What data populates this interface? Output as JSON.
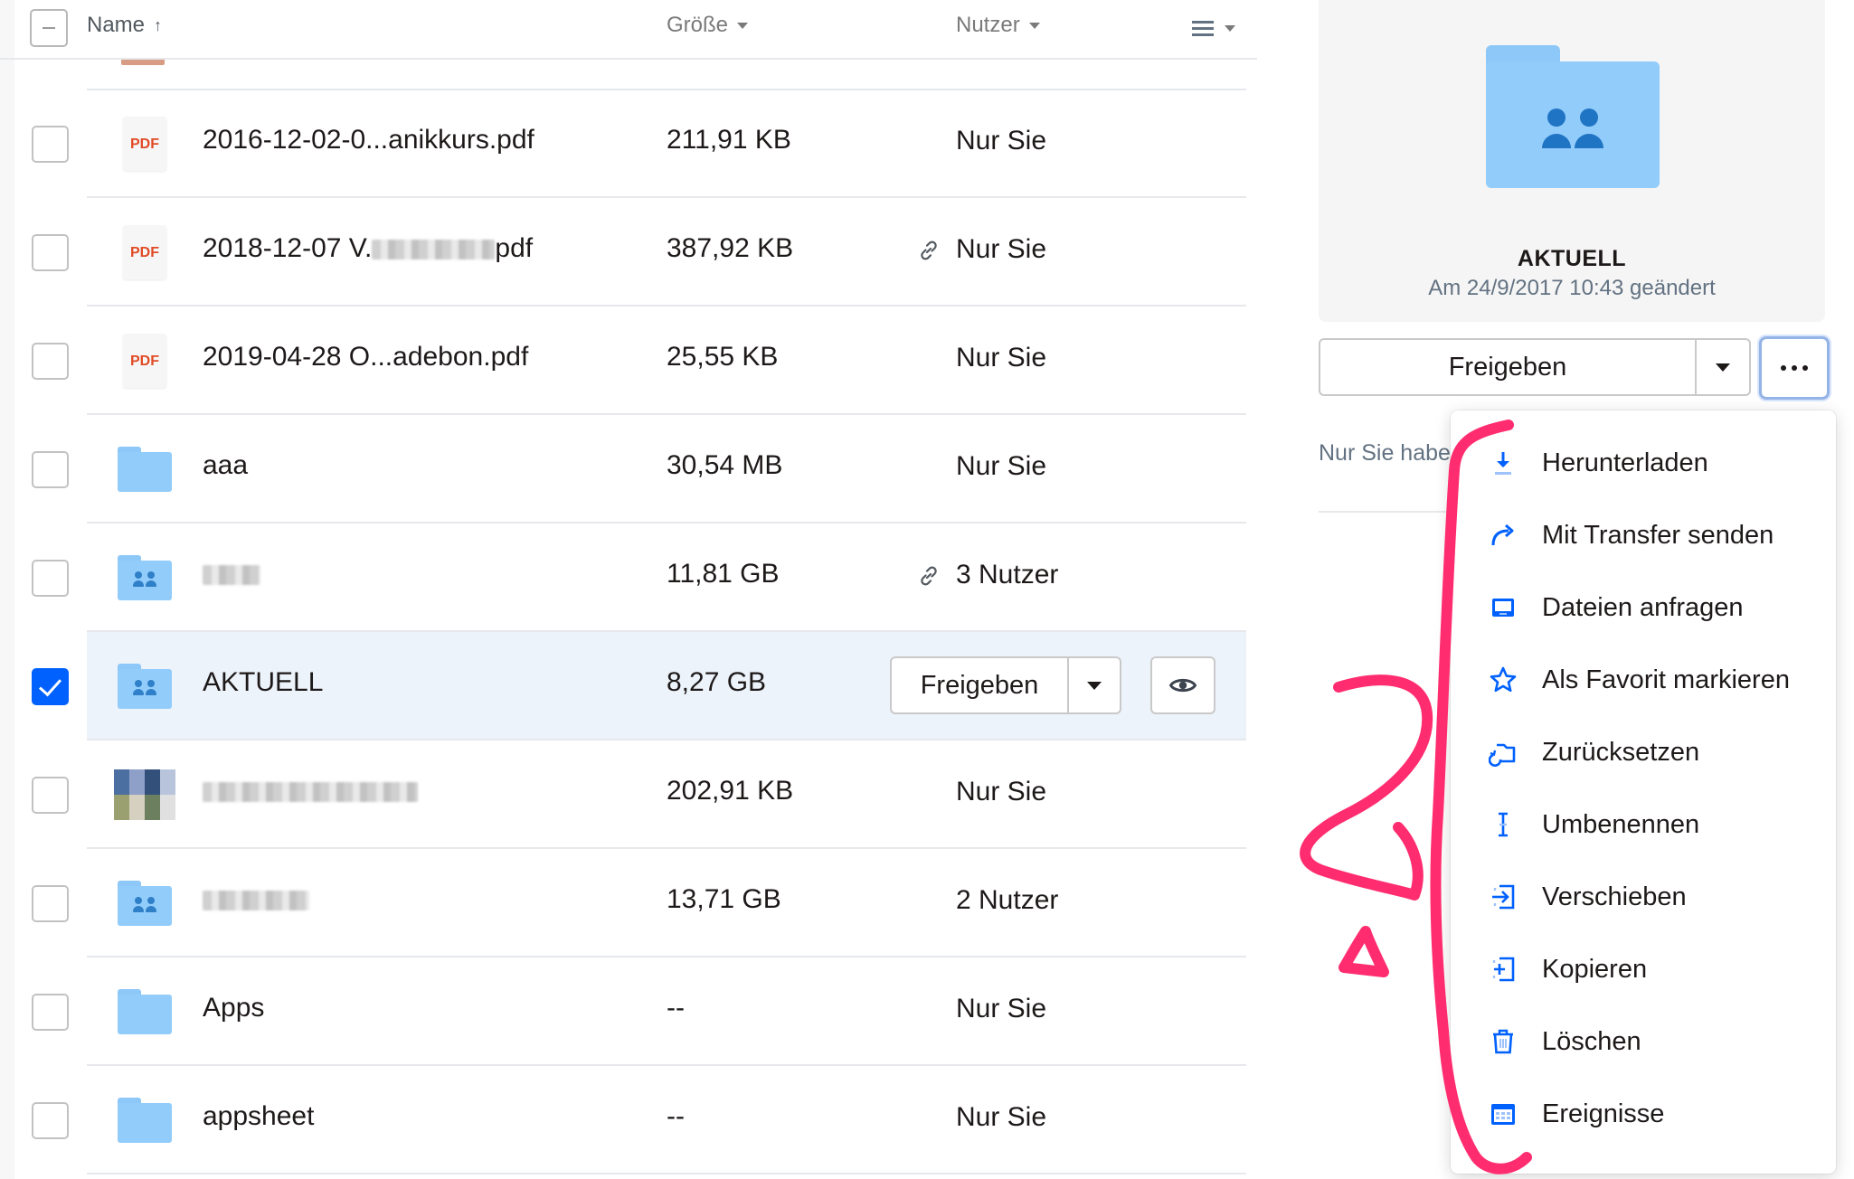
{
  "header": {
    "name_label": "Name",
    "size_label": "Größe",
    "user_label": "Nutzer"
  },
  "files": [
    {
      "icon": "pdf-icon",
      "icon_text": "PDF",
      "name": "2016-12-02-0...anikkurs.pdf",
      "size": "211,91 KB",
      "user": "Nur Sie",
      "shared_link": false,
      "checked": false
    },
    {
      "icon": "pdf-icon",
      "icon_text": "PDF",
      "name_start": "2018-12-07 V.",
      "name_end": "pdf",
      "size": "387,92 KB",
      "user": "Nur Sie",
      "shared_link": true,
      "checked": false
    },
    {
      "icon": "pdf-icon",
      "icon_text": "PDF",
      "name": "2019-04-28 O...adebon.pdf",
      "size": "25,55 KB",
      "user": "Nur Sie",
      "shared_link": false,
      "checked": false
    },
    {
      "icon": "folder-icon",
      "name": "aaa",
      "size": "30,54  MB",
      "user": "Nur Sie",
      "shared_link": false,
      "checked": false
    },
    {
      "icon": "shared-folder-icon",
      "name": "",
      "size": "11,81 GB",
      "user": "3 Nutzer",
      "shared_link": true,
      "checked": false
    },
    {
      "icon": "shared-folder-icon",
      "name": "AKTUELL",
      "size": "8,27 GB",
      "user": "",
      "checked": true,
      "share_button": "Freigeben"
    },
    {
      "icon": "image-thumbnail",
      "name": "",
      "size": "202,91 KB",
      "user": "Nur Sie",
      "shared_link": false,
      "checked": false
    },
    {
      "icon": "shared-folder-icon",
      "name": "",
      "size": "13,71 GB",
      "user": "2 Nutzer",
      "shared_link": false,
      "checked": false
    },
    {
      "icon": "folder-icon",
      "name": "Apps",
      "size": "--",
      "user": "Nur Sie",
      "shared_link": false,
      "checked": false
    },
    {
      "icon": "folder-icon",
      "name": "appsheet",
      "size": "--",
      "user": "Nur Sie",
      "shared_link": false,
      "checked": false
    }
  ],
  "details": {
    "title": "AKTUELL",
    "modified": "Am 24/9/2017 10:43 geändert",
    "share_button": "Freigeben",
    "access_text": "Nur Sie habe"
  },
  "menu": {
    "items": [
      {
        "label": "Herunterladen",
        "icon": "download-icon"
      },
      {
        "label": "Mit Transfer senden",
        "icon": "transfer-arrow-icon"
      },
      {
        "label": "Dateien anfragen",
        "icon": "file-request-icon"
      },
      {
        "label": "Als Favorit markieren",
        "icon": "star-icon"
      },
      {
        "label": "Zurücksetzen",
        "icon": "restore-icon"
      },
      {
        "label": "Umbenennen",
        "icon": "text-cursor-icon"
      },
      {
        "label": "Verschieben",
        "icon": "move-icon"
      },
      {
        "label": "Kopieren",
        "icon": "copy-icon"
      },
      {
        "label": "Löschen",
        "icon": "trash-icon"
      },
      {
        "label": "Ereignisse",
        "icon": "calendar-icon"
      }
    ]
  },
  "colors": {
    "accent": "#0061fe",
    "folder": "#92ccfa",
    "pdf_red": "#e04b26",
    "annotation": "#ff2d6f",
    "selected_row": "#edf3fb"
  }
}
